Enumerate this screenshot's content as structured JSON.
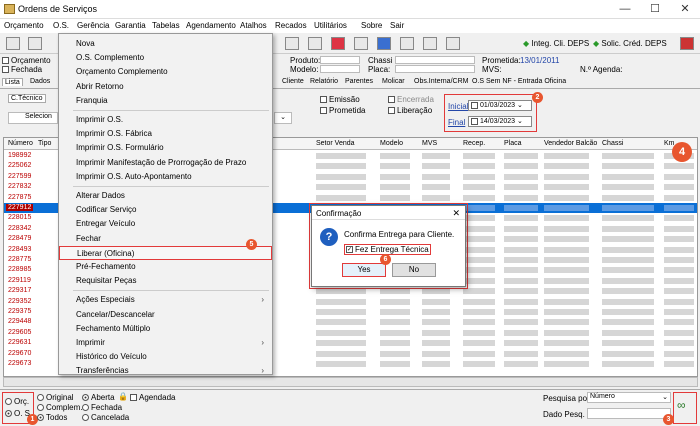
{
  "window": {
    "title": "Ordens de Serviços"
  },
  "menubar": [
    "Orçamento",
    "O.S.",
    "Gerência",
    "Garantia",
    "Tabelas",
    "Agendamento",
    "Atalhos",
    "Recados",
    "Utilitários",
    "Sobre",
    "Sair"
  ],
  "toolbar": {
    "integ": "Integ. Cli. DEPS",
    "solic": "Solic. Créd. DEPS"
  },
  "info": {
    "produto_label": "Produto:",
    "modelo_label": "Modelo:",
    "chassi_label": "Chassi",
    "placa_label": "Placa:",
    "promessa_label": "Prometida:",
    "promessa_value": "13/01/2011",
    "mvs_label": "MVS:",
    "agenda_label": "N.º Agenda:"
  },
  "left_checks": {
    "orcamento": "Orçamento",
    "fechada": "Fechada"
  },
  "tabs": [
    "Lista",
    "Dados",
    "Cliente",
    "Relatório",
    "Parentes",
    "Molicar",
    "Obs.Interna/CRM",
    "O.S Sem NF - Entrada Oficina"
  ],
  "filter": {
    "tecnico_tab": "C.Técnico",
    "selecione": "Selecion",
    "emissao": "Emissão",
    "encerrada": "Encerrada",
    "prometida": "Prometida",
    "liberacao": "Liberação",
    "inicial_label": "Inicial",
    "final_label": "Final",
    "inicial_date": "01/03/2023",
    "final_date": "14/03/2023"
  },
  "grid": {
    "headers": [
      "Número",
      "Tipo",
      "Setor Venda",
      "Modelo",
      "MVS",
      "Recep.",
      "Placa",
      "Vendedor Balcão",
      "Chassi",
      "Km"
    ],
    "rows": [
      "198992",
      "225062",
      "227599",
      "227832",
      "227875",
      "227912",
      "228015",
      "228342",
      "228479",
      "228493",
      "228775",
      "228985",
      "229119",
      "229317",
      "229352",
      "229375",
      "229448",
      "229605",
      "229631",
      "229670",
      "229673"
    ],
    "selected_row": "227912"
  },
  "context_menu": {
    "items": [
      "Nova",
      "O.S. Complemento",
      "Orçamento Complemento",
      "Abrir Retorno",
      "Franquia",
      "Imprimir O.S.",
      "Imprimir O.S. Fábrica",
      "Imprimir O.S. Formulário",
      "Imprimir Manifestação de Prorrogação de Prazo",
      "Imprimir O.S. Auto-Apontamento",
      "Alterar Dados",
      "Codificar Serviço",
      "Entregar Veículo",
      "Fechar",
      "Liberar (Oficina)",
      "Pré-Fechamento",
      "Requisitar Peças",
      "Ações Especiais",
      "Cancelar/Descancelar",
      "Fechamento Múltiplo",
      "Imprimir",
      "Histórico do Veículo",
      "Transferências"
    ],
    "highlighted": "Liberar (Oficina)"
  },
  "dialog": {
    "title": "Confirmação",
    "message": "Confirma Entrega para Cliente.",
    "checkbox": "Fez Entrega Técnica",
    "yes": "Yes",
    "no": "No"
  },
  "bottom": {
    "orc": "Orç.",
    "os": "O. S.",
    "original": "Original",
    "complem": "Complem.",
    "todos": "Todos",
    "aberta": "Aberta",
    "fechada": "Fechada",
    "cancelada": "Cancelada",
    "agendada": "Agendada",
    "pesquisa_label": "Pesquisa por",
    "pesquisa_value": "Número",
    "dado_label": "Dado Pesq."
  },
  "badges": {
    "b1": "1",
    "b2": "2",
    "b3": "3",
    "b4": "4",
    "b5": "5",
    "b6": "6"
  },
  "colors": {
    "accent": "#e23a3a",
    "badge": "#e8562f",
    "selection": "#0a6fd6"
  }
}
